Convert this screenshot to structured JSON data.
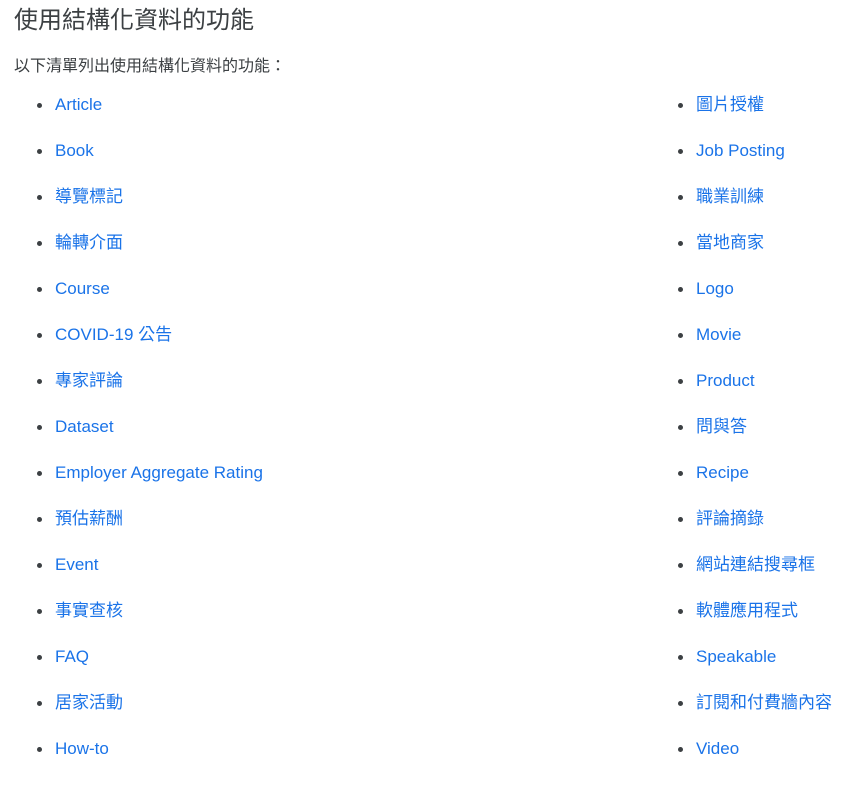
{
  "page": {
    "title": "使用結構化資料的功能",
    "intro": "以下清單列出使用結構化資料的功能：",
    "link_color": "#1a73e8",
    "text_color": "#3c4043",
    "background_color": "#ffffff"
  },
  "feature_lists": {
    "left_column": [
      {
        "label": "Article"
      },
      {
        "label": "Book"
      },
      {
        "label": "導覽標記"
      },
      {
        "label": "輪轉介面"
      },
      {
        "label": "Course"
      },
      {
        "label": "COVID-19 公告"
      },
      {
        "label": "專家評論"
      },
      {
        "label": "Dataset"
      },
      {
        "label": "Employer Aggregate Rating"
      },
      {
        "label": "預估薪酬"
      },
      {
        "label": "Event"
      },
      {
        "label": "事實查核"
      },
      {
        "label": "FAQ"
      },
      {
        "label": "居家活動"
      },
      {
        "label": "How-to"
      }
    ],
    "right_column": [
      {
        "label": "圖片授權"
      },
      {
        "label": "Job Posting"
      },
      {
        "label": "職業訓練"
      },
      {
        "label": "當地商家"
      },
      {
        "label": "Logo"
      },
      {
        "label": "Movie"
      },
      {
        "label": "Product"
      },
      {
        "label": "問與答"
      },
      {
        "label": "Recipe"
      },
      {
        "label": "評論摘錄"
      },
      {
        "label": "網站連結搜尋框"
      },
      {
        "label": "軟體應用程式"
      },
      {
        "label": "Speakable"
      },
      {
        "label": "訂閱和付費牆內容"
      },
      {
        "label": "Video"
      }
    ]
  }
}
